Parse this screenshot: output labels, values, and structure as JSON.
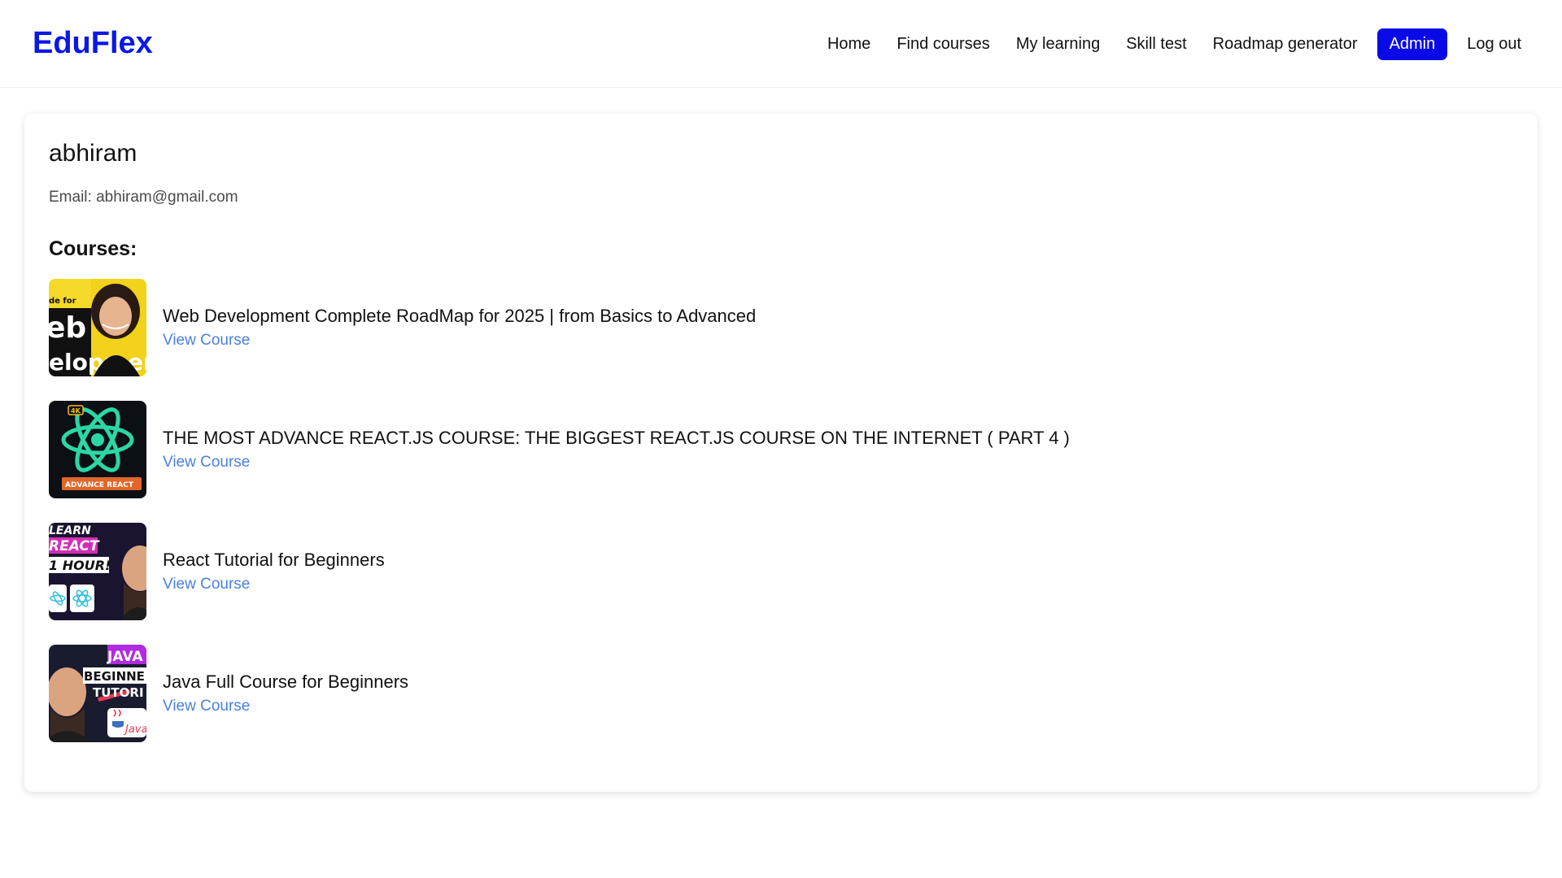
{
  "brand": {
    "name": "EduFlex",
    "color": "#0a18e6"
  },
  "nav": {
    "items": [
      {
        "label": "Home",
        "active": false
      },
      {
        "label": "Find courses",
        "active": false
      },
      {
        "label": "My learning",
        "active": false
      },
      {
        "label": "Skill test",
        "active": false
      },
      {
        "label": "Roadmap generator",
        "active": false
      },
      {
        "label": "Admin",
        "active": true
      },
      {
        "label": "Log out",
        "active": false
      }
    ],
    "active_color": "#0a0ae6"
  },
  "profile": {
    "name": "abhiram",
    "email_text": "Email: abhiram@gmail.com",
    "courses_heading": "Courses:"
  },
  "courses": [
    {
      "title": "Web Development Complete RoadMap for 2025 | from Basics to Advanced",
      "link_label": "View Course",
      "thumb_text": [
        "de for",
        "eb",
        "elopment"
      ]
    },
    {
      "title": "THE MOST ADVANCE REACT.JS COURSE: THE BIGGEST REACT.JS COURSE ON THE INTERNET ( PART 4 )",
      "link_label": "View Course",
      "thumb_text": [
        "4K",
        "ADVANCE REACT"
      ]
    },
    {
      "title": "React Tutorial for Beginners",
      "link_label": "View Course",
      "thumb_text": [
        "LEARN",
        "REACT",
        "1 HOUR!"
      ]
    },
    {
      "title": "Java Full Course for Beginners",
      "link_label": "View Course",
      "thumb_text": [
        "JAVA",
        "BEGINNE",
        "TUTORI",
        "Java"
      ]
    }
  ],
  "colors": {
    "link": "#4a80e0"
  }
}
